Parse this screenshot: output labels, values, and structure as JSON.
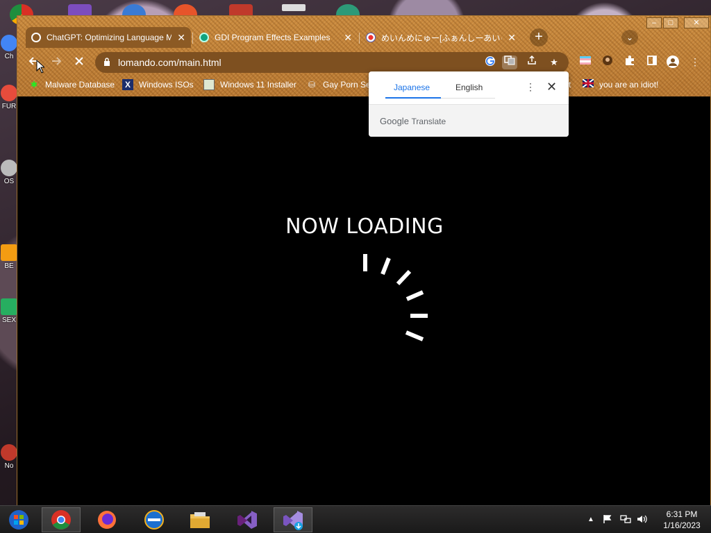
{
  "desktop": {
    "icons": [
      {
        "label": "Ch"
      },
      {
        "label": "FUR"
      },
      {
        "label": "OS"
      },
      {
        "label": "BE"
      },
      {
        "label": "SEX"
      },
      {
        "label": "No"
      }
    ]
  },
  "window": {
    "minimize": "–",
    "maximize": "□",
    "close": "✕"
  },
  "tabs": [
    {
      "title": "ChatGPT: Optimizing Language Mo",
      "favicon": "openai-icon",
      "active": true,
      "close": "✕"
    },
    {
      "title": "GDI Program Effects Examples",
      "favicon": "openai-icon",
      "active": false,
      "close": "✕"
    },
    {
      "title": "めいんめにゅー[ふぁんしーあいらんど",
      "favicon": "lomando-icon",
      "active": false,
      "close": "✕"
    }
  ],
  "new_tab_label": "+",
  "tab_search_label": "⌄",
  "toolbar": {
    "url": "lomando.com/main.html"
  },
  "bookmarks": [
    {
      "label": "Malware Database",
      "icon": "malware-icon"
    },
    {
      "label": "Windows ISOs",
      "icon": "x-icon"
    },
    {
      "label": "Windows 11 Installer",
      "icon": "image-icon"
    },
    {
      "label": "Gay Porn Sex",
      "icon": "disk-icon"
    },
    {
      "label": "t",
      "icon": ""
    },
    {
      "label": "you are an idiot!",
      "icon": "flag-icon"
    }
  ],
  "translate_popup": {
    "tabs": [
      "Japanese",
      "English"
    ],
    "active_tab": "Japanese",
    "footer_brand": "Google",
    "footer_product": "Translate",
    "menu": "⋮",
    "close": "✕"
  },
  "page": {
    "loading_text": "NOW LOADING"
  },
  "taskbar": {
    "apps": [
      "windows-start",
      "chrome",
      "firefox",
      "internet-explorer",
      "file-explorer",
      "visual-studio",
      "visual-studio-installer"
    ],
    "clock_time": "6:31 PM",
    "clock_date": "1/16/2023"
  },
  "colors": {
    "chrome_frame": "#c98a3e",
    "omnibox": "#7e5020",
    "accent_blue": "#1a73e8",
    "page_bg": "#000000"
  }
}
